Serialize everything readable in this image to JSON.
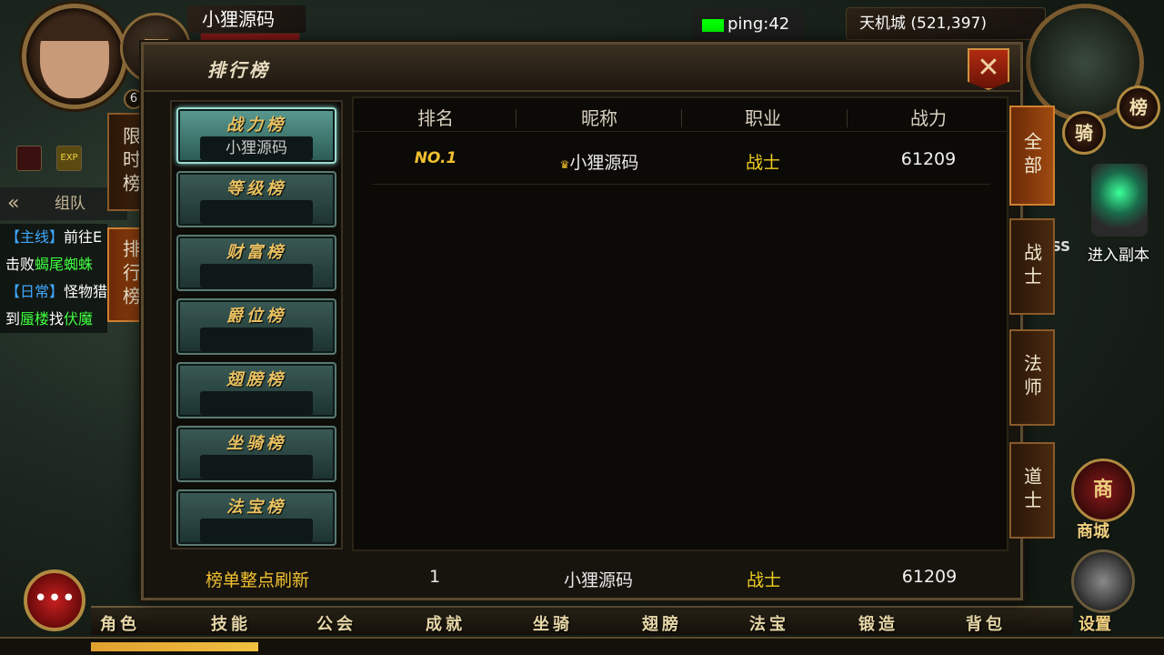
{
  "hud": {
    "player_name": "小狸源码",
    "level": "6",
    "ping": "ping:42",
    "location": "天机城 (521,397)",
    "shop_sign": "榜",
    "buffs": [
      "EXP"
    ],
    "team_label": "组队",
    "quests": [
      {
        "tag": "【主线】",
        "text": "前往",
        "suffix": "E"
      },
      {
        "pre": "击败",
        "target": "蝎尾蜘蛛",
        "suffix": ""
      },
      {
        "tag": "【日常】",
        "text": "怪物猎",
        "suffix": ""
      },
      {
        "pre": "到",
        "target": "蜃楼",
        "mid": "找",
        "target2": "伏魔"
      }
    ],
    "left_tabs": [
      "限时榜",
      "排行榜"
    ],
    "right_buttons": {
      "rank": "榜",
      "ride": "骑",
      "dungeon": "进入副本",
      "shop": "商",
      "shop_label": "商城",
      "settings_label": "设置",
      "boss_fragment": "SS"
    },
    "bottom_nav": [
      "角色",
      "技能",
      "公会",
      "成就",
      "坐骑",
      "翅膀",
      "法宝",
      "锻造",
      "背包"
    ],
    "chat_icon": "•••",
    "xp_progress": 0.17
  },
  "dialog": {
    "title": "排行榜",
    "close_label": "✕",
    "categories": [
      {
        "label": "战力榜",
        "value": "小狸源码",
        "active": true
      },
      {
        "label": "等级榜",
        "value": ""
      },
      {
        "label": "财富榜",
        "value": ""
      },
      {
        "label": "爵位榜",
        "value": ""
      },
      {
        "label": "翅膀榜",
        "value": ""
      },
      {
        "label": "坐骑榜",
        "value": ""
      },
      {
        "label": "法宝榜",
        "value": ""
      }
    ],
    "columns": [
      "排名",
      "昵称",
      "职业",
      "战力"
    ],
    "rows": [
      {
        "rank": "NO.1",
        "name": "小狸源码",
        "class": "战士",
        "power": "61209"
      }
    ],
    "class_filters": [
      "全部",
      "战士",
      "法师",
      "道士"
    ],
    "footer": {
      "refresh_note": "榜单整点刷新",
      "my_rank": "1",
      "my_name": "小狸源码",
      "my_class": "战士",
      "my_power": "61209"
    }
  }
}
